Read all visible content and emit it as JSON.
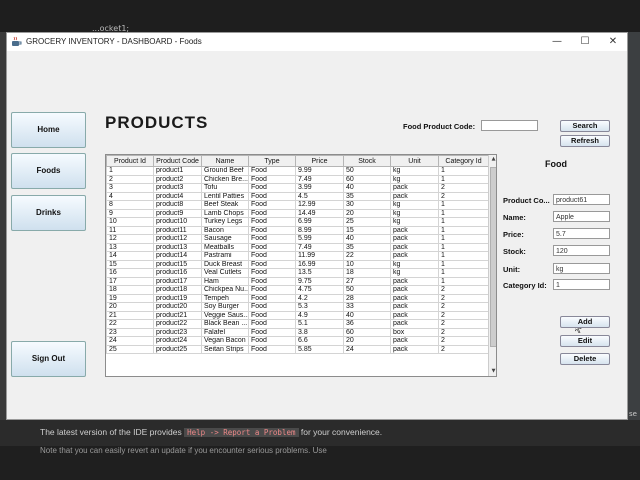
{
  "ide": {
    "tab_text": "...ocket1;",
    "right_text": "se",
    "message_prefix": "The latest version of the IDE provides",
    "message_code": "Help -> Report a Problem",
    "message_suffix": "for your convenience.",
    "message2": "Note that you can easily revert an update if you encounter serious problems. Use"
  },
  "window": {
    "title": "GROCERY INVENTORY - DASHBOARD - Foods",
    "minimize": "—",
    "maximize": "☐",
    "close": "✕"
  },
  "sidebar": {
    "home": "Home",
    "foods": "Foods",
    "drinks": "Drinks",
    "sign_out": "Sign Out"
  },
  "main": {
    "heading": "PRODUCTS",
    "search_label": "Food Product Code:",
    "search_value": "",
    "search_button": "Search",
    "refresh_button": "Refresh"
  },
  "table": {
    "columns": [
      "Product Id",
      "Product Code",
      "Name",
      "Type",
      "Price",
      "Stock",
      "Unit",
      "Category Id"
    ],
    "rows": [
      [
        "1",
        "product1",
        "Ground Beef",
        "Food",
        "9.99",
        "50",
        "kg",
        "1"
      ],
      [
        "2",
        "product2",
        "Chicken Bre...",
        "Food",
        "7.49",
        "60",
        "kg",
        "1"
      ],
      [
        "3",
        "product3",
        "Tofu",
        "Food",
        "3.99",
        "40",
        "pack",
        "2"
      ],
      [
        "4",
        "product4",
        "Lentil Patties",
        "Food",
        "4.5",
        "35",
        "pack",
        "2"
      ],
      [
        "8",
        "product8",
        "Beef Steak",
        "Food",
        "12.99",
        "30",
        "kg",
        "1"
      ],
      [
        "9",
        "product9",
        "Lamb Chops",
        "Food",
        "14.49",
        "20",
        "kg",
        "1"
      ],
      [
        "10",
        "product10",
        "Turkey Legs",
        "Food",
        "6.99",
        "25",
        "kg",
        "1"
      ],
      [
        "11",
        "product11",
        "Bacon",
        "Food",
        "8.99",
        "15",
        "pack",
        "1"
      ],
      [
        "12",
        "product12",
        "Sausage",
        "Food",
        "5.99",
        "40",
        "pack",
        "1"
      ],
      [
        "13",
        "product13",
        "Meatballs",
        "Food",
        "7.49",
        "35",
        "pack",
        "1"
      ],
      [
        "14",
        "product14",
        "Pastrami",
        "Food",
        "11.99",
        "22",
        "pack",
        "1"
      ],
      [
        "15",
        "product15",
        "Duck Breast",
        "Food",
        "16.99",
        "10",
        "kg",
        "1"
      ],
      [
        "16",
        "product16",
        "Veal Cutlets",
        "Food",
        "13.5",
        "18",
        "kg",
        "1"
      ],
      [
        "17",
        "product17",
        "Ham",
        "Food",
        "9.75",
        "27",
        "pack",
        "1"
      ],
      [
        "18",
        "product18",
        "Chickpea Nu...",
        "Food",
        "4.75",
        "50",
        "pack",
        "2"
      ],
      [
        "19",
        "product19",
        "Tempeh",
        "Food",
        "4.2",
        "28",
        "pack",
        "2"
      ],
      [
        "20",
        "product20",
        "Soy Burger",
        "Food",
        "5.3",
        "33",
        "pack",
        "2"
      ],
      [
        "21",
        "product21",
        "Veggie Saus...",
        "Food",
        "4.9",
        "40",
        "pack",
        "2"
      ],
      [
        "22",
        "product22",
        "Black Bean ...",
        "Food",
        "5.1",
        "36",
        "pack",
        "2"
      ],
      [
        "23",
        "product23",
        "Falafel",
        "Food",
        "3.8",
        "60",
        "box",
        "2"
      ],
      [
        "24",
        "product24",
        "Vegan Bacon",
        "Food",
        "6.6",
        "20",
        "pack",
        "2"
      ],
      [
        "25",
        "product25",
        "Seitan Strips",
        "Food",
        "5.85",
        "24",
        "pack",
        "2"
      ]
    ]
  },
  "form": {
    "title": "Food",
    "product_code_label": "Product Co...",
    "product_code_value": "product61",
    "name_label": "Name:",
    "name_value": "Apple",
    "price_label": "Price:",
    "price_value": "5.7",
    "stock_label": "Stock:",
    "stock_value": "120",
    "unit_label": "Unit:",
    "unit_value": "kg",
    "category_label": "Category Id:",
    "category_value": "1",
    "add_button": "Add",
    "edit_button": "Edit",
    "delete_button": "Delete"
  }
}
